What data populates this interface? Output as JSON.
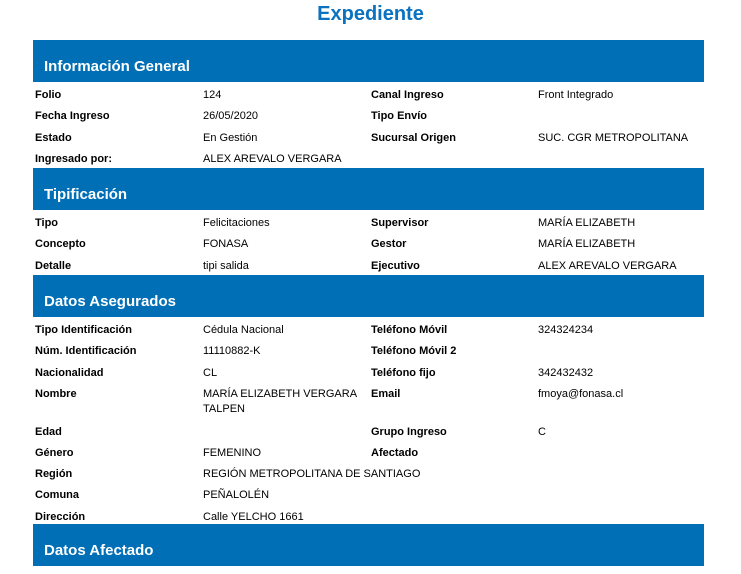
{
  "title": "Expediente",
  "sections": [
    {
      "heading": "Información General",
      "rows": [
        [
          "Folio",
          "124",
          "Canal Ingreso",
          "Front Integrado"
        ],
        [
          "Fecha Ingreso",
          "26/05/2020",
          "Tipo Envío",
          ""
        ],
        [
          "Estado",
          "En Gestión",
          "Sucursal Origen",
          "SUC. CGR METROPOLITANA"
        ],
        [
          "Ingresado por:",
          "ALEX AREVALO VERGARA",
          "",
          ""
        ]
      ]
    },
    {
      "heading": "Tipificación",
      "rows": [
        [
          "Tipo",
          "Felicitaciones",
          "Supervisor",
          "MARÍA ELIZABETH"
        ],
        [
          "Concepto",
          "FONASA",
          "Gestor",
          "MARÍA ELIZABETH"
        ],
        [
          "Detalle",
          "tipi salida",
          "Ejecutivo",
          "ALEX AREVALO VERGARA"
        ]
      ]
    },
    {
      "heading": "Datos Asegurados",
      "rows": [
        [
          "Tipo Identificación",
          "Cédula Nacional",
          "Teléfono Móvil",
          "324324234"
        ],
        [
          "Núm. Identificación",
          "11110882-K",
          "Teléfono Móvil 2",
          ""
        ],
        [
          "Nacionalidad",
          "CL",
          "Teléfono fijo",
          "342432432"
        ],
        [
          "Nombre",
          "MARÍA ELIZABETH VERGARA TALPEN",
          "Email",
          "fmoya@fonasa.cl"
        ],
        [
          "Edad",
          "",
          "Grupo Ingreso",
          "C"
        ],
        [
          "Género",
          "FEMENINO",
          "Afectado",
          ""
        ],
        [
          "Región",
          "REGIÓN METROPOLITANA DE SANTIAGO",
          "",
          ""
        ],
        [
          "Comuna",
          "PEÑALOLÉN",
          "",
          ""
        ],
        [
          "Dirección",
          "Calle YELCHO 1661",
          "",
          ""
        ]
      ]
    },
    {
      "heading": "Datos Afectado",
      "rows": []
    }
  ]
}
